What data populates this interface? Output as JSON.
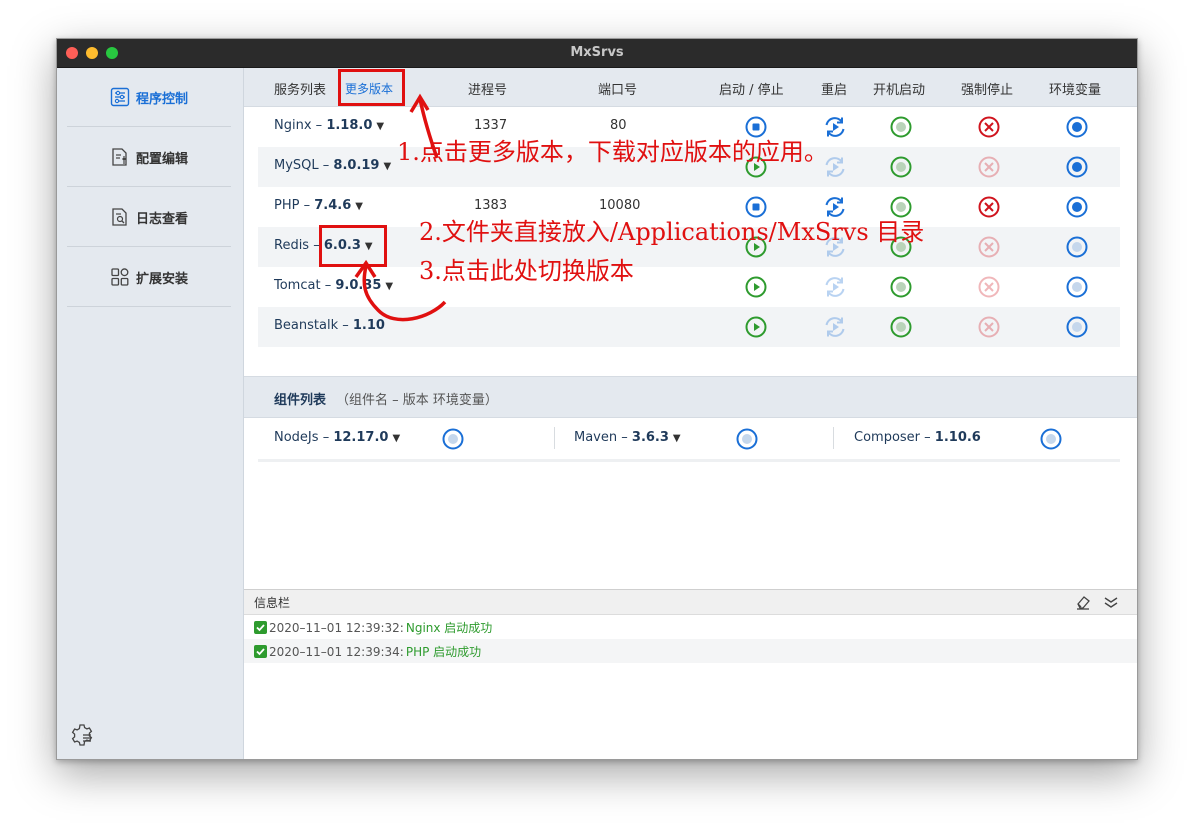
{
  "window": {
    "title": "MxSrvs"
  },
  "sidebar": {
    "items": [
      {
        "label": "程序控制",
        "icon": "sliders-icon",
        "active": true
      },
      {
        "label": "配置编辑",
        "icon": "config-edit-icon",
        "active": false
      },
      {
        "label": "日志查看",
        "icon": "log-search-icon",
        "active": false
      },
      {
        "label": "扩展安装",
        "icon": "extensions-icon",
        "active": false
      }
    ],
    "settings_icon": "settings-gear-icon"
  },
  "service_table": {
    "headers": {
      "name": "服务列表",
      "more_versions": "更多版本",
      "pid": "进程号",
      "port": "端口号",
      "start_stop": "启动 / 停止",
      "restart": "重启",
      "autostart": "开机启动",
      "force_stop": "强制停止",
      "env": "环境变量"
    },
    "rows": [
      {
        "name": "Nginx",
        "sep": "–",
        "version": "1.18.0",
        "dropdown": true,
        "pid": "1337",
        "port": "80",
        "running": true,
        "restart_enabled": true,
        "autostart": true,
        "force_stop_enabled": true,
        "env": true
      },
      {
        "name": "MySQL",
        "sep": "–",
        "version": "8.0.19",
        "dropdown": true,
        "pid": "",
        "port": "",
        "running": false,
        "restart_enabled": false,
        "autostart": true,
        "force_stop_enabled": false,
        "env": true
      },
      {
        "name": "PHP",
        "sep": "–",
        "version": "7.4.6",
        "dropdown": true,
        "pid": "1383",
        "port": "10080",
        "running": true,
        "restart_enabled": true,
        "autostart": true,
        "force_stop_enabled": true,
        "env": true
      },
      {
        "name": "Redis",
        "sep": "–",
        "version": "6.0.3",
        "dropdown": true,
        "pid": "",
        "port": "",
        "running": false,
        "restart_enabled": false,
        "autostart": true,
        "force_stop_enabled": false,
        "env": false
      },
      {
        "name": "Tomcat",
        "sep": "–",
        "version": "9.0.35",
        "dropdown": true,
        "pid": "",
        "port": "",
        "running": false,
        "restart_enabled": false,
        "autostart": true,
        "force_stop_enabled": false,
        "env": false
      },
      {
        "name": "Beanstalk",
        "sep": "–",
        "version": "1.10",
        "dropdown": false,
        "pid": "",
        "port": "",
        "running": false,
        "restart_enabled": false,
        "autostart": true,
        "force_stop_enabled": false,
        "env": false
      }
    ]
  },
  "component_table": {
    "title": "组件列表",
    "subtitle": "（组件名 – 版本 环境变量）",
    "items": [
      {
        "name": "NodeJs",
        "sep": "–",
        "version": "12.17.0",
        "dropdown": true,
        "env": false
      },
      {
        "name": "Maven",
        "sep": "–",
        "version": "3.6.3",
        "dropdown": true,
        "env": false
      },
      {
        "name": "Composer",
        "sep": "–",
        "version": "1.10.6",
        "dropdown": false,
        "env": false
      }
    ]
  },
  "info_bar": {
    "title": "信息栏",
    "clear_icon": "eraser-icon",
    "collapse_icon": "double-chevron-down-icon",
    "logs": [
      {
        "time": "2020–11–01 12:39:32:",
        "msg": "Nginx 启动成功"
      },
      {
        "time": "2020–11–01 12:39:34:",
        "msg": "PHP 启动成功"
      }
    ]
  },
  "annotations": {
    "step1": "1.点击更多版本，下载对应版本的应用。",
    "step2": "2.文件夹直接放入/Applications/MxSrvs 目录",
    "step3": "3.点击此处切换版本"
  },
  "colors": {
    "accent_blue": "#1a6fd6",
    "green": "#2e9b2e",
    "red": "#d0141e",
    "annotation_red": "#e01010",
    "header_bg": "#e4e9ef"
  }
}
